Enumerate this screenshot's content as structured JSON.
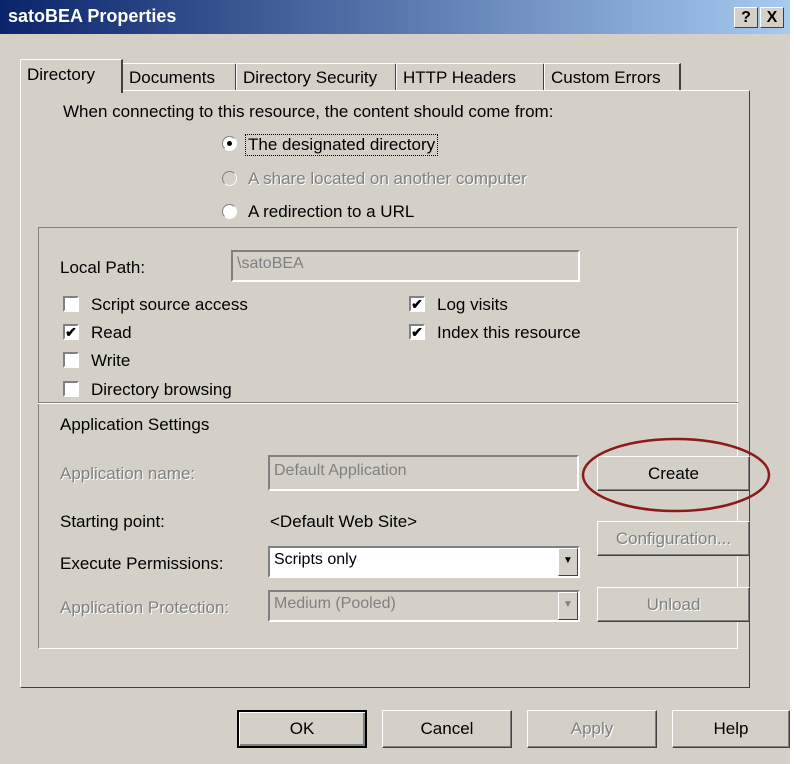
{
  "window": {
    "title": "satoBEA Properties",
    "help_button": "?",
    "close_button": "X"
  },
  "tabs": [
    {
      "label": "Directory",
      "active": true
    },
    {
      "label": "Documents"
    },
    {
      "label": "Directory Security"
    },
    {
      "label": "HTTP Headers"
    },
    {
      "label": "Custom Errors"
    }
  ],
  "content_source": {
    "prompt": "When connecting to this resource, the content should come from:",
    "options": [
      {
        "label": "The designated directory",
        "selected": true,
        "enabled": true
      },
      {
        "label": "A share located on another computer",
        "selected": false,
        "enabled": false
      },
      {
        "label": "A redirection to a URL",
        "selected": false,
        "enabled": true
      }
    ]
  },
  "local_path": {
    "label": "Local Path:",
    "value": "\\satoBEA"
  },
  "checkboxes": {
    "script_source_access": {
      "label": "Script source access",
      "checked": false
    },
    "read": {
      "label": "Read",
      "checked": true
    },
    "write": {
      "label": "Write",
      "checked": false
    },
    "directory_browsing": {
      "label": "Directory browsing",
      "checked": false
    },
    "log_visits": {
      "label": "Log visits",
      "checked": true
    },
    "index_resource": {
      "label": "Index this resource",
      "checked": true
    }
  },
  "app_settings": {
    "heading": "Application Settings",
    "app_name_label": "Application name:",
    "app_name_value": "Default Application",
    "create_button": "Create",
    "starting_point_label": "Starting point:",
    "starting_point_value": "<Default Web Site>",
    "configuration_button": "Configuration...",
    "execute_permissions_label": "Execute Permissions:",
    "execute_permissions_value": "Scripts only",
    "app_protection_label": "Application Protection:",
    "app_protection_value": "Medium (Pooled)",
    "unload_button": "Unload"
  },
  "footer": {
    "ok": "OK",
    "cancel": "Cancel",
    "apply": "Apply",
    "help": "Help"
  },
  "colors": {
    "annotation_circle": "#8b1a1a",
    "title_gradient_start": "#0a246a",
    "dialog_face": "#d4d0c8"
  }
}
